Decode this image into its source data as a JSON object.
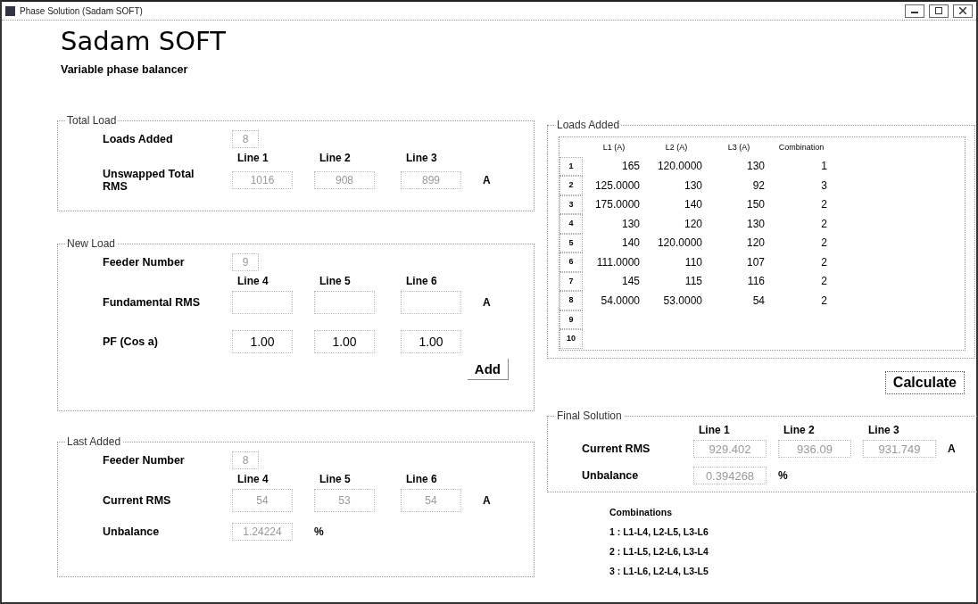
{
  "window": {
    "title": "Phase Solution (Sadam SOFT)"
  },
  "app_title": "Sadam SOFT",
  "subtitle": "Variable phase balancer",
  "total_load": {
    "title": "Total Load",
    "count_label": "Loads Added",
    "count_value": "8",
    "columns": [
      "Line 1",
      "Line 2",
      "Line 3"
    ],
    "rms_label": "Unswapped Total RMS",
    "rms_values": [
      "1016",
      "908",
      "899"
    ],
    "unit": "A"
  },
  "new_load": {
    "title": "New Load",
    "feeder_label": "Feeder Number",
    "feeder_value": "9",
    "columns": [
      "Line 4",
      "Line 5",
      "Line 6"
    ],
    "rms_label": "Fundamental RMS",
    "unit": "A",
    "pf_label": "PF (Cos a)",
    "pf_values": [
      "1.00",
      "1.00",
      "1.00"
    ],
    "add_button": "Add"
  },
  "last_added": {
    "title": "Last Added",
    "feeder_label": "Feeder Number",
    "feeder_value": "8",
    "columns": [
      "Line 4",
      "Line 5",
      "Line 6"
    ],
    "rms_label": "Current RMS",
    "rms_values": [
      "54",
      "53",
      "54"
    ],
    "unit": "A",
    "unbalance_label": "Unbalance",
    "unbalance_value": "1.24224",
    "unbalance_unit": "%"
  },
  "loads_added": {
    "title": "Loads Added",
    "columns": [
      "L1 (A)",
      "L2 (A)",
      "L3 (A)",
      "Combination"
    ],
    "rows": [
      {
        "header": "1",
        "cells": [
          "165",
          "120.0000",
          "130",
          "1"
        ]
      },
      {
        "header": "2",
        "cells": [
          "125.0000",
          "130",
          "92",
          "3"
        ]
      },
      {
        "header": "3",
        "cells": [
          "175.0000",
          "140",
          "150",
          "2"
        ]
      },
      {
        "header": "4",
        "cells": [
          "130",
          "120",
          "130",
          "2"
        ]
      },
      {
        "header": "5",
        "cells": [
          "140",
          "120.0000",
          "120",
          "2"
        ]
      },
      {
        "header": "6",
        "cells": [
          "111.0000",
          "110",
          "107",
          "2"
        ]
      },
      {
        "header": "7",
        "cells": [
          "145",
          "115",
          "116",
          "2"
        ]
      },
      {
        "header": "8",
        "cells": [
          "54.0000",
          "53.0000",
          "54",
          "2"
        ]
      },
      {
        "header": "9"
      },
      {
        "header": "10"
      }
    ]
  },
  "calculate_button": "Calculate",
  "final_solution": {
    "title": "Final Solution",
    "columns": [
      "Line 1",
      "Line 2",
      "Line 3"
    ],
    "rms_label": "Current RMS",
    "rms_values": [
      "929.402",
      "936.09",
      "931.749"
    ],
    "unit": "A",
    "unbalance_label": "Unbalance",
    "unbalance_value": "0.394268",
    "unbalance_unit": "%"
  },
  "combinations": {
    "title": "Combinations",
    "items": [
      "1 : L1-L4, L2-L5, L3-L6",
      "2 : L1-L5, L2-L6, L3-L4",
      "3 : L1-L6, L2-L4, L3-L5"
    ]
  }
}
